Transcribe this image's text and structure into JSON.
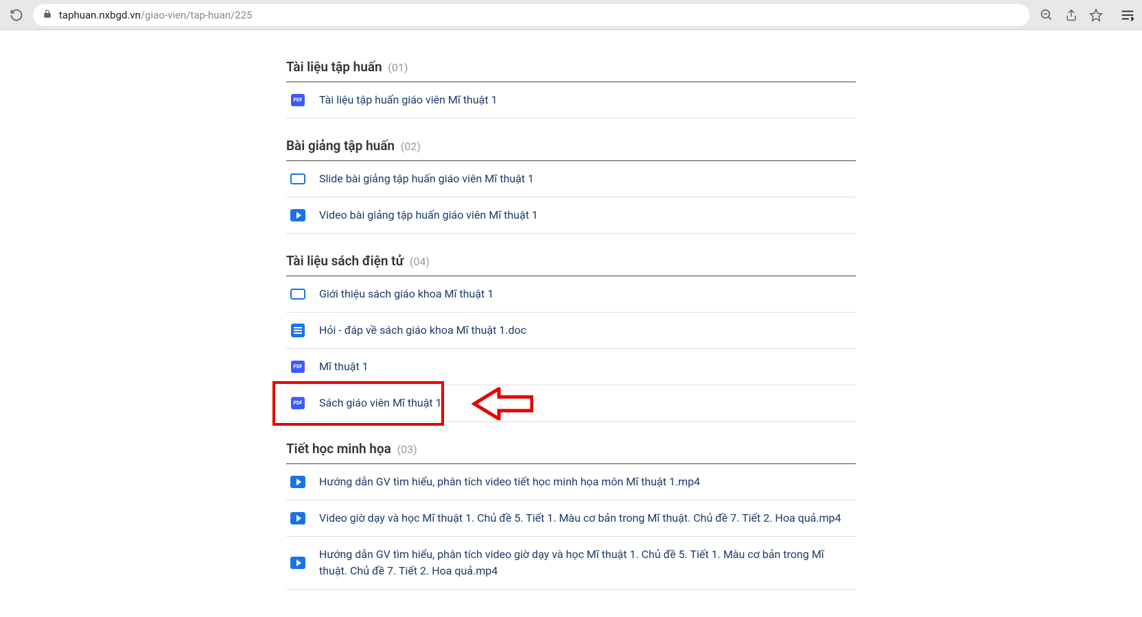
{
  "browser": {
    "url_domain": "taphuan.nxbgd.vn",
    "url_path": "/giao-vien/tap-huan/225"
  },
  "sections": [
    {
      "title": "Tài liệu tập huấn",
      "count": "(01)",
      "items": [
        {
          "icon": "pdf",
          "label": "Tài liệu tập huấn giáo viên Mĩ thuật 1"
        }
      ]
    },
    {
      "title": "Bài giảng tập huấn",
      "count": "(02)",
      "items": [
        {
          "icon": "slide",
          "label": "Slide bài giảng tập huấn giáo viên Mĩ thuật 1"
        },
        {
          "icon": "video",
          "label": "Video bài giảng tập huấn giáo viên Mĩ thuật 1"
        }
      ]
    },
    {
      "title": "Tài liệu sách điện tử",
      "count": "(04)",
      "items": [
        {
          "icon": "slide",
          "label": "Giới thiệu sách giáo khoa Mĩ thuật 1"
        },
        {
          "icon": "doc",
          "label": "Hỏi - đáp về sách giáo khoa Mĩ thuật 1.doc"
        },
        {
          "icon": "pdf",
          "label": "Mĩ thuật 1"
        },
        {
          "icon": "pdf",
          "label": "Sách giáo viên Mĩ thuật 1",
          "highlighted": true
        }
      ]
    },
    {
      "title": "Tiết học minh họa",
      "count": "(03)",
      "items": [
        {
          "icon": "video",
          "label": "Hướng dẫn GV tìm hiểu, phân tích video tiết học minh họa môn Mĩ thuật 1.mp4"
        },
        {
          "icon": "video",
          "label": "Video giờ dạy và học Mĩ thuật 1. Chủ đề 5. Tiết 1. Màu cơ bản trong Mĩ thuật. Chủ đề 7. Tiết 2. Hoa quả.mp4"
        },
        {
          "icon": "video",
          "label": "Hướng dẫn GV tìm hiểu, phân tích video giờ dạy và học Mĩ thuật 1. Chủ đề 5. Tiết 1. Màu cơ bản trong Mĩ thuật. Chủ đề 7. Tiết 2. Hoa quả.mp4"
        }
      ]
    }
  ],
  "pdf_label": "PDF"
}
